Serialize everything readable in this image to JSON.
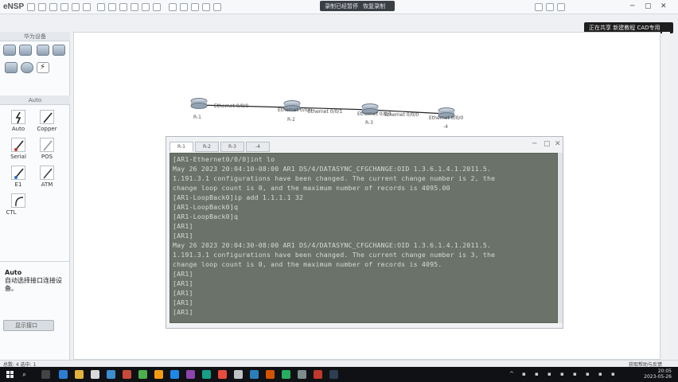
{
  "app": {
    "logo": "eNSP",
    "recording_bar": [
      "录制已经暂停",
      "恢复录制"
    ]
  },
  "notification": {
    "text": "正在共享 新建教程 CAD专用",
    "button": "停止"
  },
  "left_panel": {
    "devices_header": "华为设备",
    "cables_header": "Auto",
    "cables": [
      "Auto",
      "Copper",
      "Serial",
      "POS",
      "E1",
      "ATM",
      "CTL"
    ],
    "desc_title": "Auto",
    "desc_text": "自动选择接口连接设备。",
    "button_label": "显示接口"
  },
  "topology": {
    "routers": [
      "R-1",
      "R-2",
      "R-3",
      "-4"
    ],
    "port_labels": [
      "Ethernet 0/0/0",
      "Ethernet 0/0/0",
      "Ethernet 0/0/1",
      "Ethernet 0/0/1",
      "Ethernet 0/0/0",
      "Ethernet 0/0/0"
    ]
  },
  "console": {
    "tabs": [
      "R-1",
      "R-2",
      "R-3",
      "-4"
    ],
    "lines": [
      "[AR1-Ethernet0/0/0]int lo",
      "May 26 2023 20:04:10-08:00 AR1 DS/4/DATASYNC_CFGCHANGE:OID 1.3.6.1.4.1.2011.5.",
      "1.191.3.1 configurations have been changed. The current change number is 2, the",
      "change loop count is 0, and the maximum number of records is 4095.00",
      "[AR1-LoopBack0]ip add 1.1.1.1 32",
      "[AR1-LoopBack0]q",
      "[AR1-LoopBack0]q",
      "[AR1]",
      "[AR1]",
      "May 26 2023 20:04:30-08:00 AR1 DS/4/DATASYNC_CFGCHANGE:OID 1.3.6.1.4.1.2011.5.",
      "1.191.3.1 configurations have been changed. The current change number is 3, the",
      "change loop count is 0, and the maximum number of records is 4095.",
      "[AR1]",
      "[AR1]",
      "[AR1]",
      "[AR1]",
      "[AR1]"
    ]
  },
  "status": {
    "left": "总数: 4 选中: 1",
    "right": "获取帮助与反馈"
  },
  "taskbar": {
    "time": "20:05",
    "date": "2023-05-26"
  }
}
